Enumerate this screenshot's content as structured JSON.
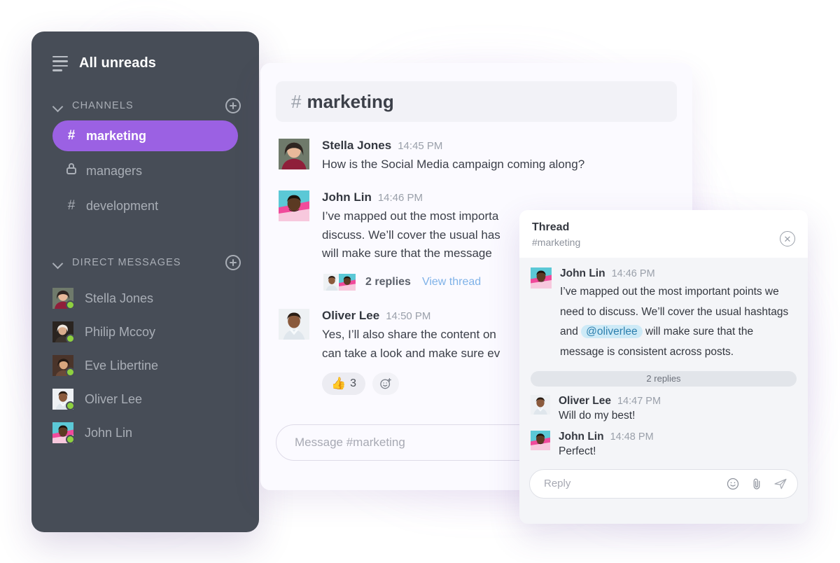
{
  "sidebar": {
    "title": "All unreads",
    "menu_icon": "hamburger-icon",
    "sections": [
      {
        "label": "CHANNELS",
        "add_icon": "plus-circle-icon"
      },
      {
        "label": "DIRECT MESSAGES",
        "add_icon": "plus-circle-icon"
      }
    ],
    "channels": [
      {
        "name": "marketing",
        "glyph": "#",
        "type": "public",
        "active": true
      },
      {
        "name": "managers",
        "glyph": "lock-icon",
        "type": "private",
        "active": false
      },
      {
        "name": "development",
        "glyph": "#",
        "type": "public",
        "active": false
      }
    ],
    "direct_messages": [
      {
        "name": "Stella Jones",
        "status": "online"
      },
      {
        "name": "Philip Mccoy",
        "status": "online"
      },
      {
        "name": "Eve Libertine",
        "status": "online"
      },
      {
        "name": "Oliver Lee",
        "status": "online"
      },
      {
        "name": "John Lin",
        "status": "online"
      }
    ]
  },
  "channel": {
    "hash": "#",
    "name": "marketing",
    "messages": [
      {
        "author": "Stella Jones",
        "time": "14:45 PM",
        "text": "How is the Social Media campaign coming along?"
      },
      {
        "author": "John Lin",
        "time": "14:46 PM",
        "line1": "I’ve mapped out the most importa",
        "line2": "discuss. We’ll cover the usual has",
        "line3": "will make sure that the message",
        "replies_count": "2 replies",
        "view_thread": "View thread"
      },
      {
        "author": "Oliver Lee",
        "time": "14:50 PM",
        "line1": "Yes, I’ll also share the content on",
        "line2": "can take a look and make sure ev",
        "reactions": [
          {
            "emoji": "👍",
            "count": "3"
          }
        ],
        "add_reaction_icon": "add-reaction-icon"
      }
    ],
    "composer_placeholder": "Message #marketing"
  },
  "thread": {
    "title": "Thread",
    "subtitle": "#marketing",
    "close_icon": "close-circle-icon",
    "root": {
      "author": "John Lin",
      "time": "14:46 PM",
      "text_before": "I’ve mapped out the most important points we need to discuss. We’ll cover the usual hashtags and ",
      "mention": "@oliverlee",
      "text_after": " will make sure that the message is consistent across posts."
    },
    "divider_label": "2 replies",
    "replies": [
      {
        "author": "Oliver Lee",
        "time": "14:47 PM",
        "text": "Will do my best!"
      },
      {
        "author": "John Lin",
        "time": "14:48 PM",
        "text": "Perfect!"
      }
    ],
    "composer_placeholder": "Reply",
    "composer_icons": [
      "emoji-icon",
      "attachment-icon",
      "send-icon"
    ]
  },
  "colors": {
    "accent": "#9b61e3",
    "sidebar_bg": "#474d57",
    "panel_bg": "#fbfaff",
    "thread_bg": "#f4f5f8",
    "link": "#7fb2e8",
    "mention_bg": "#cdeaf7",
    "online": "#8ed13f"
  }
}
